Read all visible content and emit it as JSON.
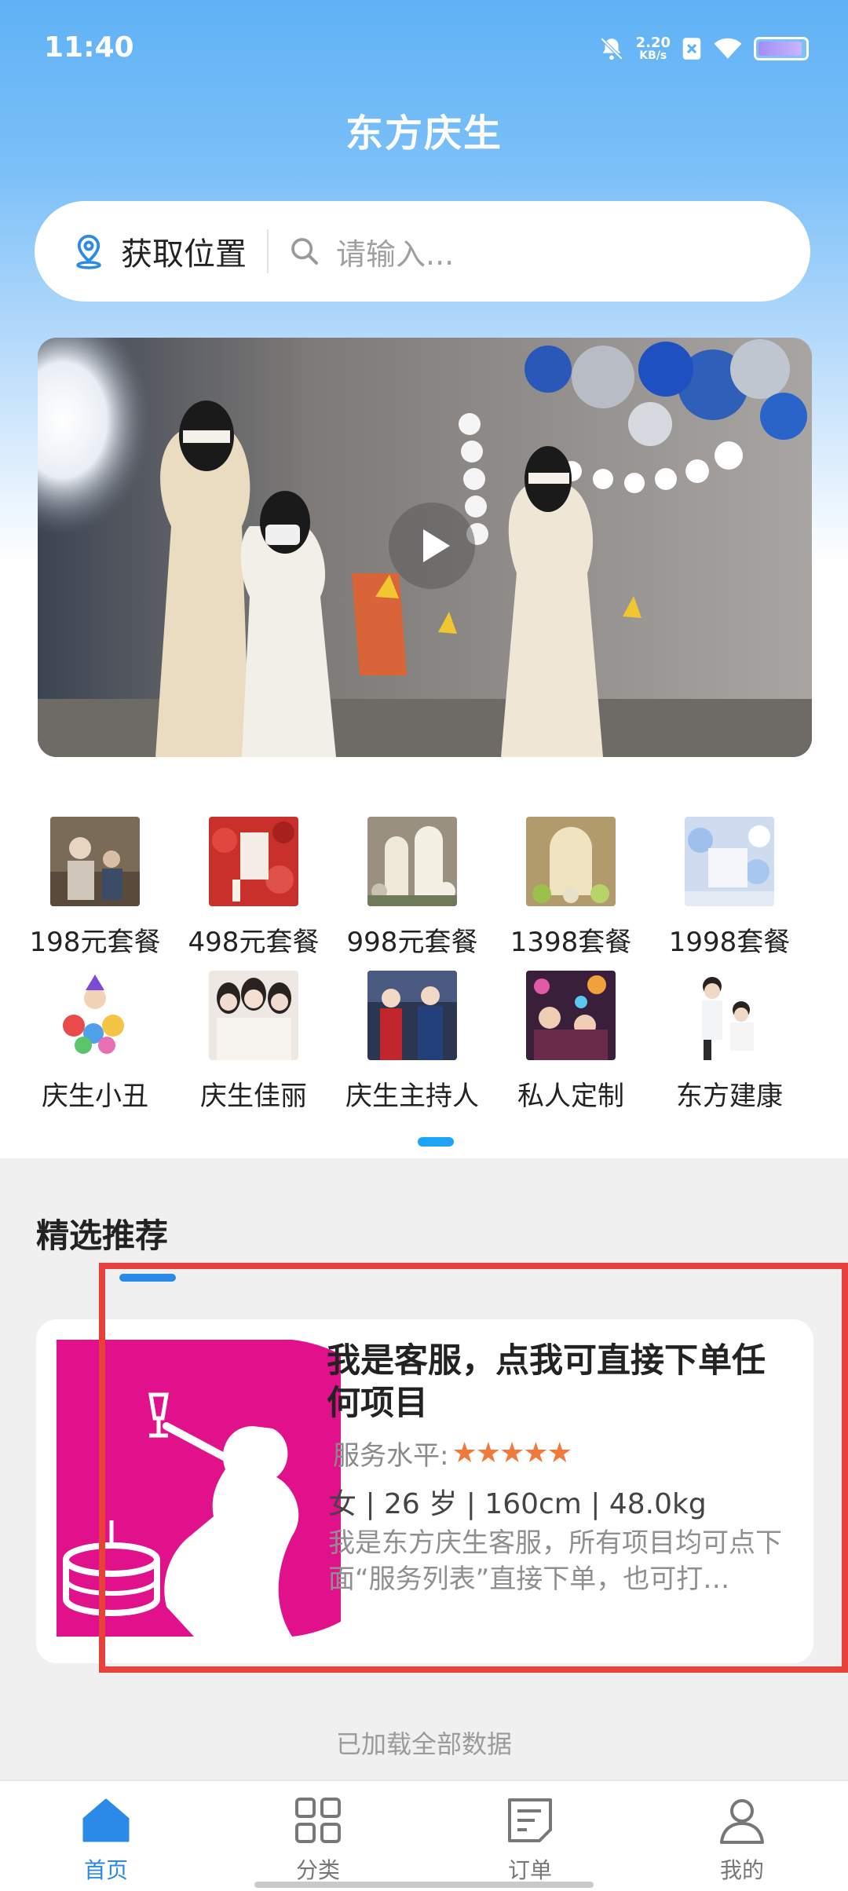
{
  "status_bar": {
    "time": "11:40",
    "net_speed_value": "2.20",
    "net_speed_unit": "KB/s",
    "icons": [
      "mute-icon",
      "net-speed",
      "sim-off-icon",
      "wifi-icon",
      "battery-icon"
    ]
  },
  "header": {
    "title": "东方庆生"
  },
  "search": {
    "location_label": "获取位置",
    "placeholder": "请输入..."
  },
  "banner": {
    "description_icon": "play-icon"
  },
  "categories": [
    {
      "label": "198元套餐"
    },
    {
      "label": "498元套餐"
    },
    {
      "label": "998元套餐"
    },
    {
      "label": "1398套餐"
    },
    {
      "label": "1998套餐"
    },
    {
      "label": "庆生小丑"
    },
    {
      "label": "庆生佳丽"
    },
    {
      "label": "庆生主持人"
    },
    {
      "label": "私人定制"
    },
    {
      "label": "东方建康"
    }
  ],
  "featured": {
    "section_title": "精选推荐",
    "card": {
      "title": "我是客服，点我可直接下单任何项目",
      "rating_label": "服务水平:",
      "stars": "★★★★★",
      "info": "女 | 26 岁 | 160cm | 48.0kg",
      "description": "我是东方庆生客服，所有项目均可点下面“服务列表”直接下单，也可打…"
    }
  },
  "footer_text": "已加载全部数据",
  "tabbar": {
    "items": [
      {
        "label": "首页",
        "icon": "home-icon",
        "active": true
      },
      {
        "label": "分类",
        "icon": "grid-icon",
        "active": false
      },
      {
        "label": "订单",
        "icon": "order-icon",
        "active": false
      },
      {
        "label": "我的",
        "icon": "user-icon",
        "active": false
      }
    ],
    "active_color": "#2b8ae8"
  },
  "colors": {
    "accent": "#2b8ae8",
    "star": "#f07a3c",
    "highlight_frame": "#e8403a"
  }
}
